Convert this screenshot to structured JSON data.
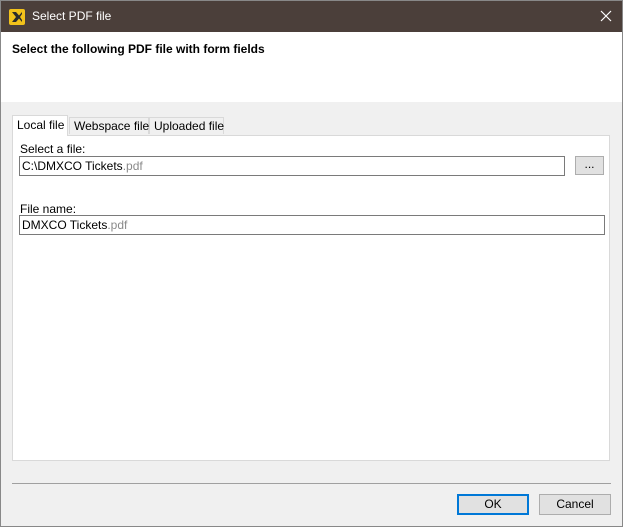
{
  "window": {
    "title": "Select PDF file",
    "colors": {
      "titlebar": "#4b3f3a",
      "app_icon": "#f2c21b",
      "accent": "#0078d7"
    },
    "icons": {
      "app": "app-logo-icon",
      "close": "close-icon"
    }
  },
  "header": {
    "title": "Select the following PDF file with form fields"
  },
  "tabs": [
    {
      "label": "Local file",
      "active": true
    },
    {
      "label": "Webspace file",
      "active": false
    },
    {
      "label": "Uploaded file",
      "active": false
    }
  ],
  "local_file": {
    "select_label": "Select a file:",
    "select_value_name": "C:\\DMXCO Tickets",
    "select_value_ext": ".pdf",
    "browse_label": "...",
    "filename_label": "File name:",
    "filename_value_name": "DMXCO Tickets",
    "filename_value_ext": ".pdf"
  },
  "buttons": {
    "ok": "OK",
    "cancel": "Cancel"
  }
}
